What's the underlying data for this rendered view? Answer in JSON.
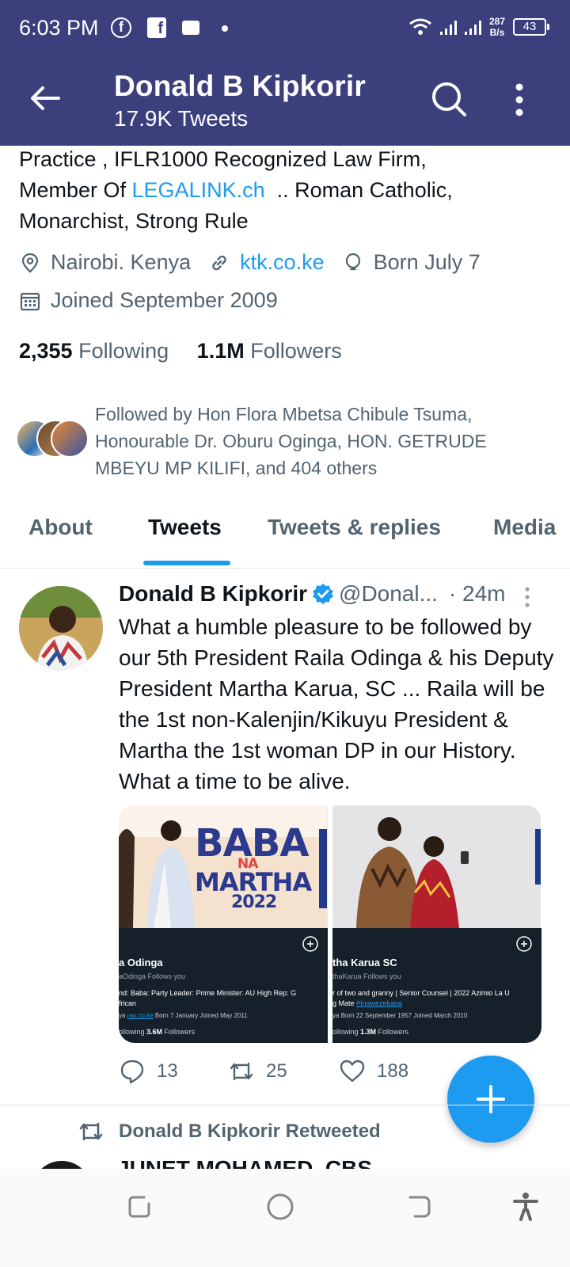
{
  "status_bar": {
    "time": "6:03 PM",
    "net_speed_value": "287",
    "net_speed_unit": "B/s",
    "battery": "43"
  },
  "header": {
    "title": "Donald B Kipkorir",
    "subtitle": "17.9K Tweets"
  },
  "profile": {
    "bio_line1": "Practice , IFLR1000 Recognized Law Firm,",
    "bio_line2_pre": "Member Of ",
    "bio_link": "LEGALINK.ch",
    "bio_line2_post": "  .. Roman Catholic,",
    "bio_line3": "Monarchist, Strong Rule",
    "location": "Nairobi. Kenya",
    "website": "ktk.co.ke",
    "birthday": "Born July 7",
    "joined": "Joined September 2009",
    "following_count": "2,355",
    "following_label": "Following",
    "followers_count": "1.1M",
    "followers_label": "Followers",
    "followed_by": "Followed by Hon Flora Mbetsa Chibule Tsuma, Honourable Dr. Oburu Oginga, HON. GETRUDE MBEYU MP KILIFI, and 404 others"
  },
  "tabs": [
    "About",
    "Tweets",
    "Tweets & replies",
    "Media"
  ],
  "active_tab": "Tweets",
  "tweet": {
    "name": "Donald B Kipkorir",
    "handle": "@Donal...",
    "time": "· 24m",
    "text": "What a humble pleasure to be followed by our 5th President Raila Odinga & his Deputy President Martha Karua, SC ... Raila will be the 1st non-Kalenjin/Kikuyu President & Martha the 1st woman DP in our History. What a time to be alive.",
    "media": [
      {
        "poster_l1": "BABA",
        "poster_l2": "NA",
        "poster_l3": "MARTHA",
        "poster_l4": "2022",
        "card_name": "a Odinga",
        "card_handle": "aOdinga   Follows you",
        "card_bio": "nd: Baba: Party Leader: Prime Minister: AU High Rep: G",
        "card_bio2": "frican",
        "card_meta_prefix": "ya",
        "card_meta_link": "rao.co.ke",
        "card_meta_rest": "Born 7 January   Joined May 2011",
        "card_stats_pre": "ollowing ",
        "card_stats_val": "3.6M",
        "card_stats_post": " Followers"
      },
      {
        "card_name": "tha Karua SC",
        "card_handle": "thaKarua   Follows you",
        "card_bio": "r of two and granny | Senior Counsel | 2022 Azimio La U",
        "card_bio2_pre": "g Mate ",
        "card_bio2_link": "#Inawezekana",
        "card_meta_prefix": "ya",
        "card_meta_rest": "Born 22 September 1957   Joined March 2010",
        "card_stats_pre": "ollowing ",
        "card_stats_val": "1.3M",
        "card_stats_post": " Followers"
      }
    ],
    "replies": "13",
    "retweets": "25",
    "likes": "188"
  },
  "retweet_notice": "Donald B Kipkorir Retweeted",
  "next_tweet_name": "JUNET MOHAMED, CBS",
  "colors": {
    "header_bg": "#3b3f7c",
    "accent": "#1d9bf0",
    "text": "#0f1419",
    "muted": "#536471"
  }
}
